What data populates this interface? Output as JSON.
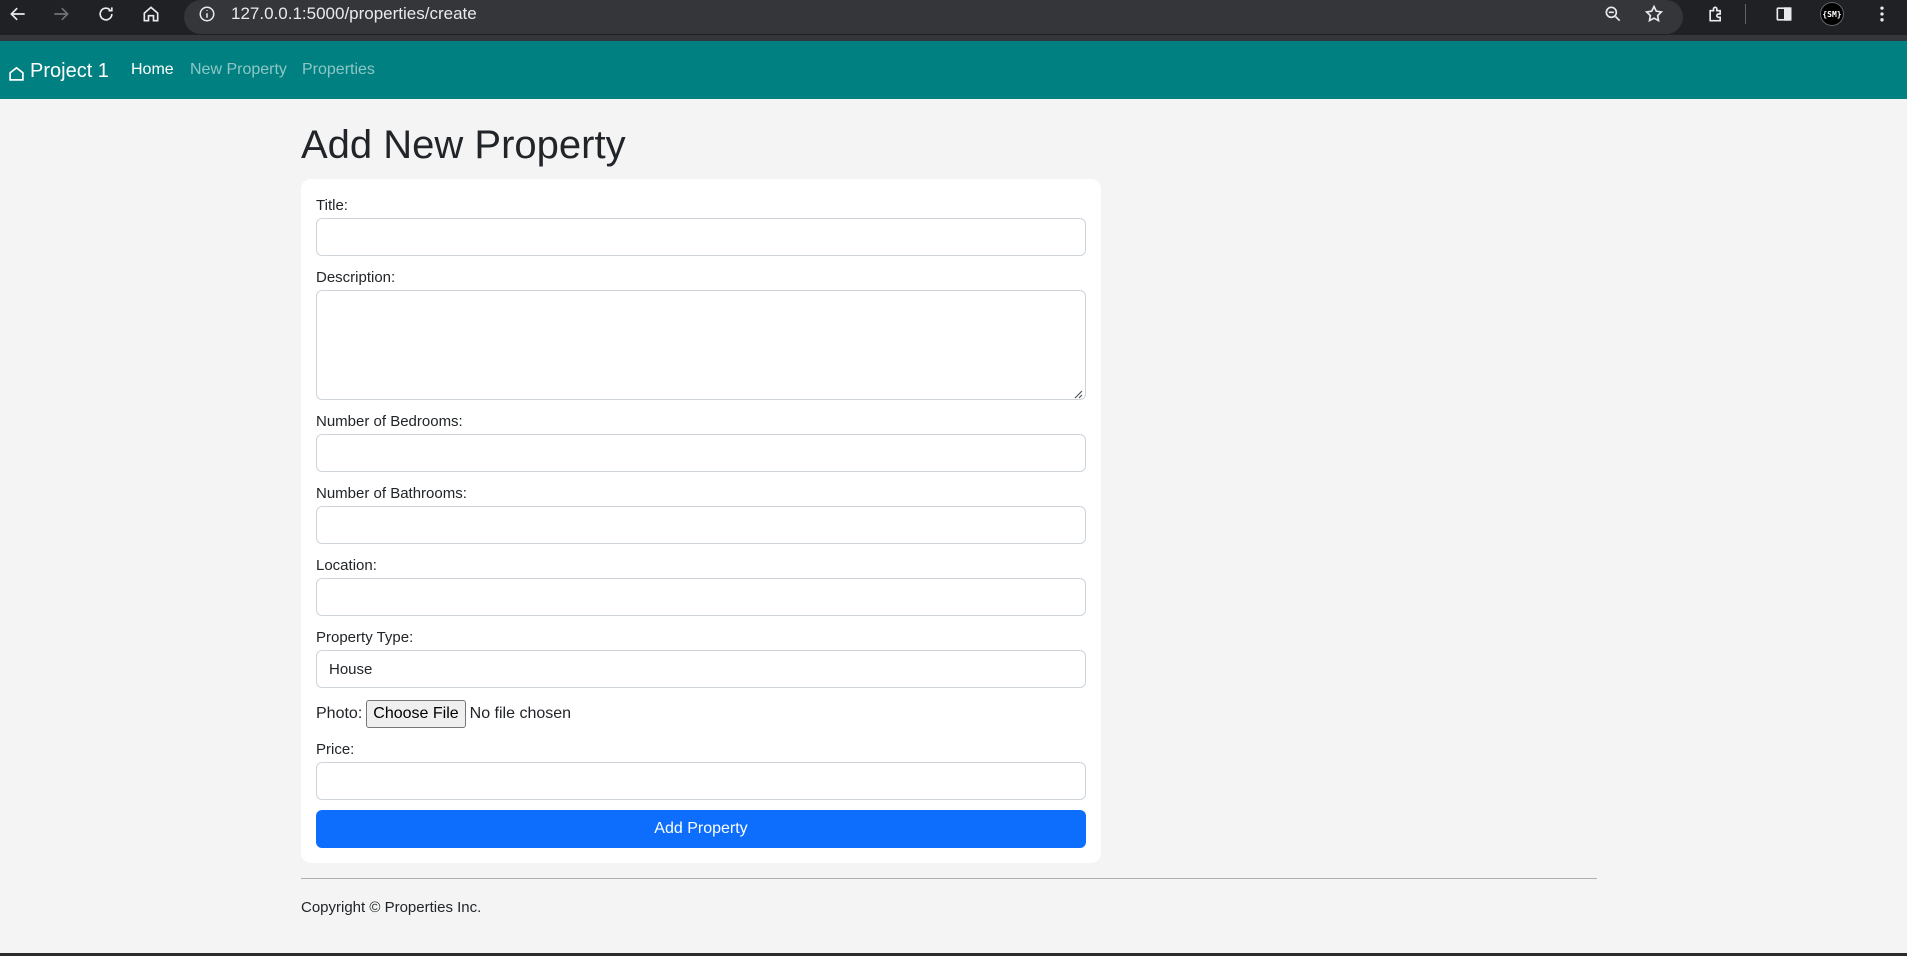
{
  "browser": {
    "url": "127.0.0.1:5000/properties/create",
    "profile_label": "{SM}",
    "icons": [
      "back-icon",
      "forward-icon",
      "reload-icon",
      "home-icon",
      "info-icon",
      "zoom-icon",
      "star-icon",
      "extensions-icon",
      "side-panel-icon",
      "menu-icon"
    ]
  },
  "navbar": {
    "brand": "Project 1",
    "brand_icon": "house-icon",
    "links": [
      {
        "label": "Home"
      },
      {
        "label": "New Property"
      },
      {
        "label": "Properties"
      }
    ],
    "colors": {
      "background": "#008080"
    }
  },
  "page": {
    "title": "Add New Property"
  },
  "form": {
    "title_label": "Title:",
    "title_value": "",
    "description_label": "Description:",
    "description_value": "",
    "bedrooms_label": "Number of Bedrooms:",
    "bedrooms_value": "",
    "bathrooms_label": "Number of Bathrooms:",
    "bathrooms_value": "",
    "location_label": "Location:",
    "location_value": "",
    "type_label": "Property Type:",
    "type_selected": "House",
    "photo_label": "Photo:",
    "photo_button": "Choose File",
    "photo_status": "No file chosen",
    "price_label": "Price:",
    "price_value": "",
    "submit_label": "Add Property",
    "colors": {
      "submit": "#0d6efd"
    }
  },
  "footer": {
    "text": "Copyright © Properties Inc."
  }
}
